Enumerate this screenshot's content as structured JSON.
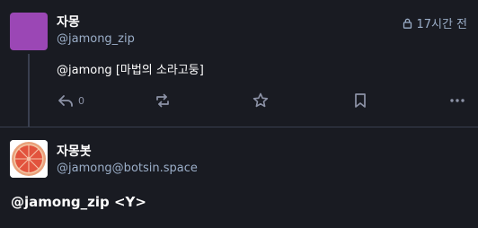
{
  "status1": {
    "display_name": "자몽",
    "acct": "@jamong_zip",
    "visibility_icon": "lock-icon",
    "time": "17시간 전",
    "mention": "@jamong",
    "text": " [마법의 소라고둥]",
    "actions": {
      "reply_count": "0",
      "reply_icon": "reply-icon",
      "boost_icon": "boost-icon",
      "favourite_icon": "star-icon",
      "bookmark_icon": "bookmark-icon",
      "more_icon": "more-icon"
    },
    "avatar_color": "#9b47b5"
  },
  "status2": {
    "display_name": "자몽봇",
    "acct": "@jamong@botsin.space",
    "text": "@jamong_zip <Y>",
    "avatar_icon": "grapefruit-icon"
  },
  "colors": {
    "background": "#191b22",
    "secondary_text": "#9baec8",
    "icon": "#8d93a7",
    "divider": "#393f4f"
  }
}
